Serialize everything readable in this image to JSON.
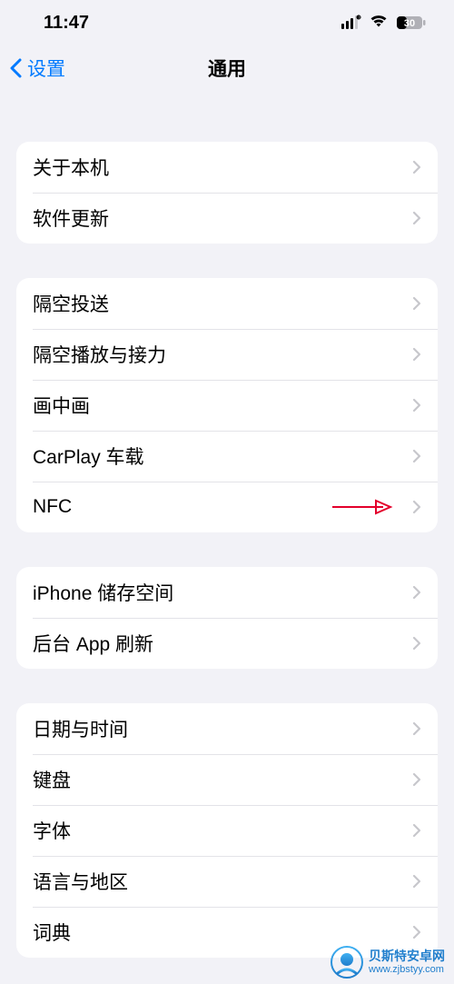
{
  "status": {
    "time": "11:47",
    "battery_percent": "30"
  },
  "nav": {
    "back_label": "设置",
    "title": "通用"
  },
  "groups": [
    {
      "id": "about",
      "rows": [
        {
          "id": "about-device",
          "label": "关于本机"
        },
        {
          "id": "software-update",
          "label": "软件更新"
        }
      ]
    },
    {
      "id": "connect",
      "rows": [
        {
          "id": "airdrop",
          "label": "隔空投送"
        },
        {
          "id": "airplay",
          "label": "隔空播放与接力"
        },
        {
          "id": "pip",
          "label": "画中画"
        },
        {
          "id": "carplay",
          "label": "CarPlay 车载"
        },
        {
          "id": "nfc",
          "label": "NFC",
          "highlight": true
        }
      ]
    },
    {
      "id": "storage",
      "rows": [
        {
          "id": "iphone-storage",
          "label": "iPhone 储存空间"
        },
        {
          "id": "background-refresh",
          "label": "后台 App 刷新"
        }
      ]
    },
    {
      "id": "system",
      "rows": [
        {
          "id": "date-time",
          "label": "日期与时间"
        },
        {
          "id": "keyboard",
          "label": "键盘"
        },
        {
          "id": "fonts",
          "label": "字体"
        },
        {
          "id": "language-region",
          "label": "语言与地区"
        },
        {
          "id": "dictionary",
          "label": "词典"
        }
      ]
    }
  ],
  "watermark": {
    "title": "贝斯特安卓网",
    "url": "www.zjbstyy.com"
  }
}
